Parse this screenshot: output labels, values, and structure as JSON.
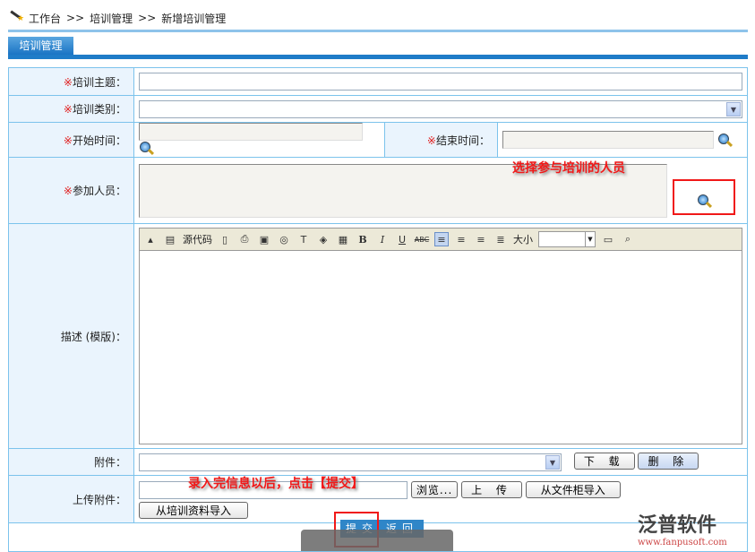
{
  "breadcrumb": {
    "items": [
      "工作台",
      ">>",
      "培训管理",
      ">>",
      "新增培训管理"
    ]
  },
  "tab": {
    "label": "培训管理"
  },
  "form": {
    "required_mark": "※",
    "subject_label": "培训主题：",
    "subject_value": "",
    "category_label": "培训类别：",
    "category_value": "",
    "start_label": "开始时间：",
    "start_value": "",
    "end_label": "结束时间：",
    "end_value": "",
    "participants_label": "参加人员：",
    "description_label": "描述 (模版)：",
    "attachment_label": "附件：",
    "upload_label": "上传附件："
  },
  "editor": {
    "source_label": "源代码",
    "size_label": "大小",
    "bold": "B",
    "italic": "I",
    "underline": "U",
    "strike": "ABC",
    "textcolor": "T"
  },
  "buttons": {
    "download": "下 载",
    "delete": "删 除",
    "browse": "浏览...",
    "upload": "上 传",
    "from_cabinet": "从文件柜导入",
    "from_training": "从培训资料导入",
    "submit": "提交",
    "back": "返回"
  },
  "annotations": {
    "select_people": "选择参与培训的人员",
    "submit_hint": "录入完信息以后，点击【提交】"
  },
  "watermark": {
    "brand": "泛普软件",
    "url": "www.fanpusoft.com"
  },
  "colors": {
    "accent": "#1f7cc8",
    "annotation": "#f01818"
  }
}
